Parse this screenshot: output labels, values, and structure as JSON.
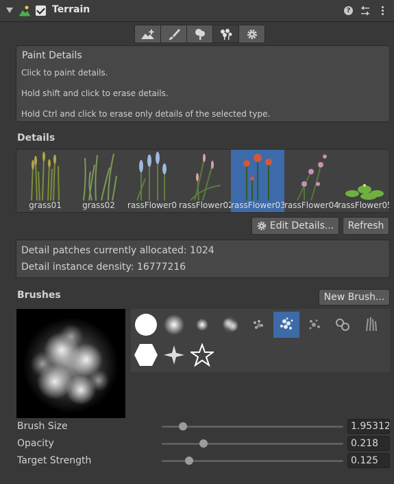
{
  "header": {
    "title": "Terrain",
    "help_glyph": "?"
  },
  "toolbar": {
    "tools": [
      {
        "name": "raise-terrain-icon",
        "active": false
      },
      {
        "name": "paint-brush-icon",
        "active": false
      },
      {
        "name": "paint-trees-icon",
        "active": false
      },
      {
        "name": "paint-details-icon",
        "active": true
      },
      {
        "name": "settings-gear-icon",
        "active": false
      }
    ]
  },
  "help": {
    "title": "Paint Details",
    "line1": "Click to paint details.",
    "line2": "Hold shift and click to erase details.",
    "line3": "Hold Ctrl and click to erase only details of the selected type."
  },
  "details": {
    "label": "Details",
    "items": [
      {
        "label": "grass01",
        "selected": false
      },
      {
        "label": "grass02",
        "selected": false
      },
      {
        "label": "rassFlower0",
        "selected": false
      },
      {
        "label": "rassFlower02",
        "selected": false
      },
      {
        "label": "rassFlower03",
        "selected": true
      },
      {
        "label": "rassFlower04",
        "selected": false
      },
      {
        "label": "rassFlower05",
        "selected": false
      }
    ],
    "edit_label": "Edit Details...",
    "refresh_label": "Refresh"
  },
  "info": {
    "patches": "Detail patches currently allocated: 1024",
    "density": "Detail instance density: 16777216"
  },
  "brushes": {
    "label": "Brushes",
    "new_label": "New Brush...",
    "selected_index": 5,
    "items": [
      "hard-circle",
      "soft-circle",
      "small-soft",
      "cloud",
      "noise",
      "splatter",
      "dust",
      "rings",
      "grass-strokes",
      "hexagon",
      "star-burst",
      "star-outline"
    ]
  },
  "settings": {
    "brush_size": {
      "label": "Brush Size",
      "value": "1.95312",
      "fraction": 0.1
    },
    "opacity": {
      "label": "Opacity",
      "value": "0.218",
      "fraction": 0.218
    },
    "target_strength": {
      "label": "Target Strength",
      "value": "0.125",
      "fraction": 0.135
    }
  },
  "colors": {
    "selection": "#3d6aa8",
    "panel": "#383838"
  }
}
